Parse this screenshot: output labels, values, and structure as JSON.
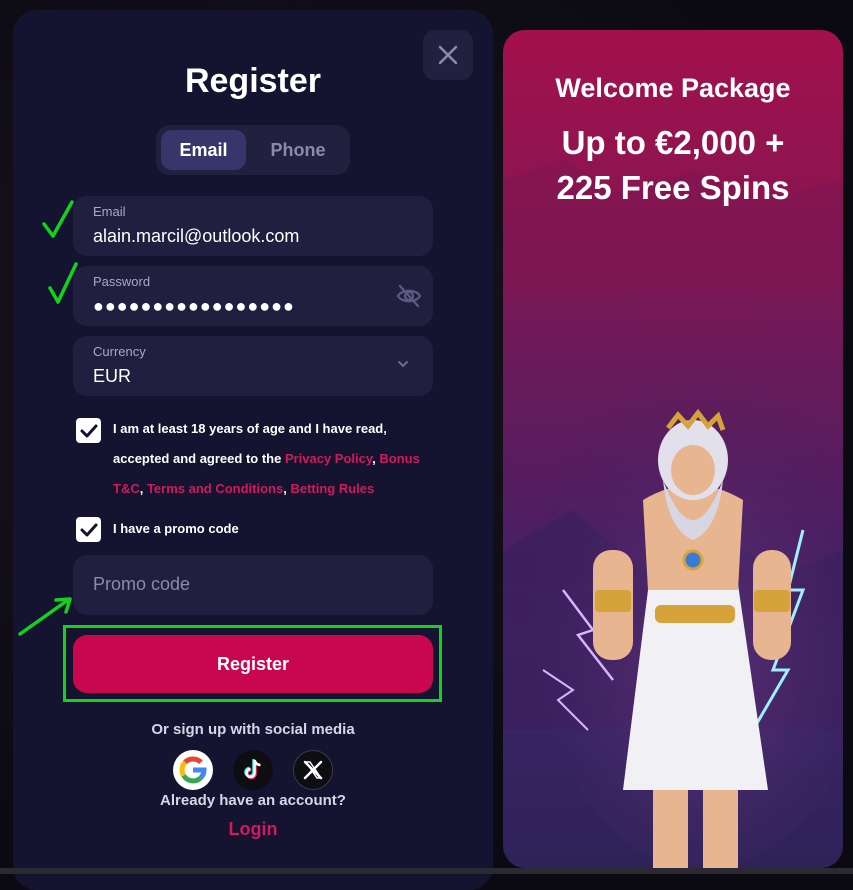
{
  "modal": {
    "title": "Register",
    "tabs": [
      {
        "label": "Email",
        "active": true
      },
      {
        "label": "Phone",
        "active": false
      }
    ],
    "email": {
      "label": "Email",
      "value": "alain.marcil@outlook.com"
    },
    "password": {
      "label": "Password",
      "value": "●●●●●●●●●●●●●●●●●"
    },
    "currency": {
      "label": "Currency",
      "value": "EUR"
    },
    "terms": {
      "checked": true,
      "text_before": "I am at least 18 years of age and I have read, accepted and agreed to the ",
      "privacy_policy": "Privacy Policy",
      "sep1": ", ",
      "bonus_tc": "Bonus T&C",
      "sep2": ", ",
      "terms_conditions": "Terms and Conditions",
      "sep3": ", ",
      "betting_rules": "Betting Rules"
    },
    "promo_check": {
      "checked": true,
      "label": "I have a promo code"
    },
    "promo_input": {
      "placeholder": "Promo code"
    },
    "register_button": "Register",
    "social_text": "Or sign up with social media",
    "social": [
      "google-icon",
      "tiktok-icon",
      "x-icon"
    ],
    "have_account": "Already have an account?",
    "login_link": "Login"
  },
  "promo_panel": {
    "headline": "Welcome Package",
    "offer_line1": "Up to €2,000 +",
    "offer_line2": "225 Free Spins"
  },
  "colors": {
    "accent": "#c8074f",
    "link": "#d11a5c",
    "modal_bg": "#151430",
    "field_bg": "#201f40",
    "annotation_green": "#13d21c"
  }
}
